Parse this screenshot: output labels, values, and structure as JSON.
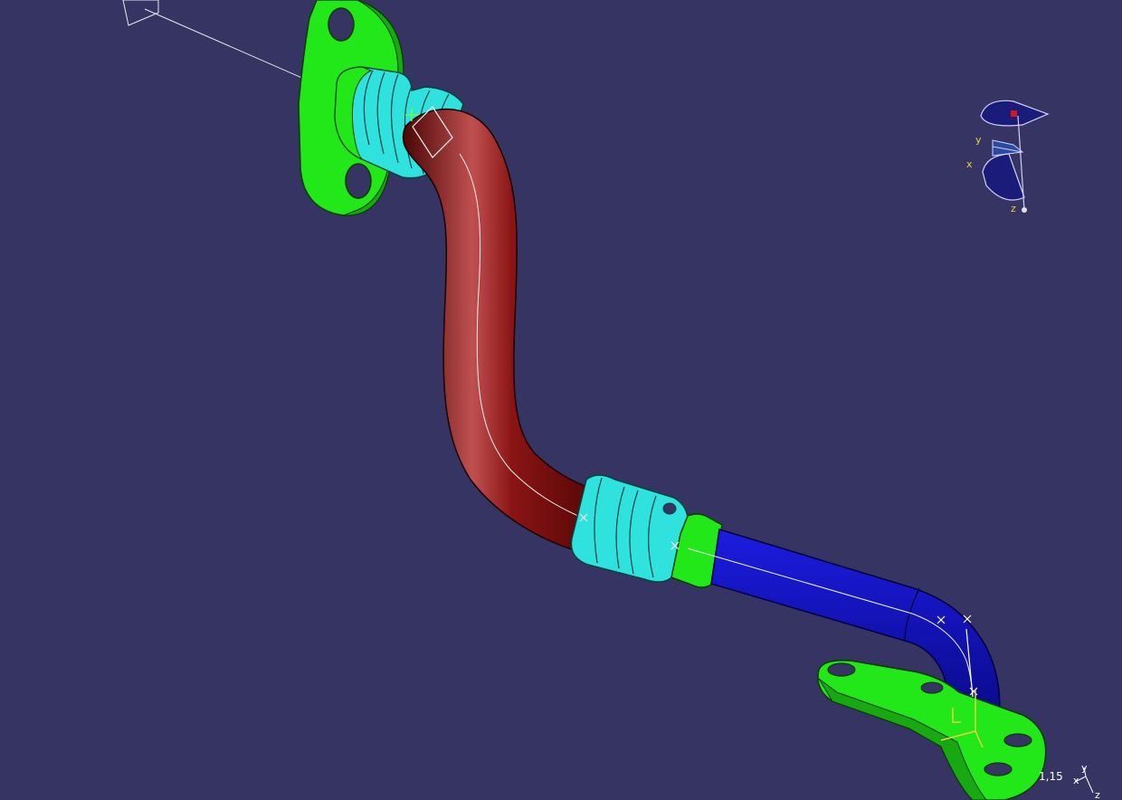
{
  "viewport": {
    "background": "#363463",
    "zoom_label": "1,15"
  },
  "compass": {
    "x_label": "x",
    "y_label": "y",
    "z_label": "z"
  },
  "mini_axis": {
    "y_label": "y",
    "x_label": "x",
    "z_label": "z"
  },
  "colors": {
    "flange": "#22e81a",
    "fitting": "#2fe2de",
    "tube_upper": "#7a0d0d",
    "tube_lower": "#1414c8",
    "highlight": "#ffffff",
    "axis_label": "#e8d23a"
  }
}
